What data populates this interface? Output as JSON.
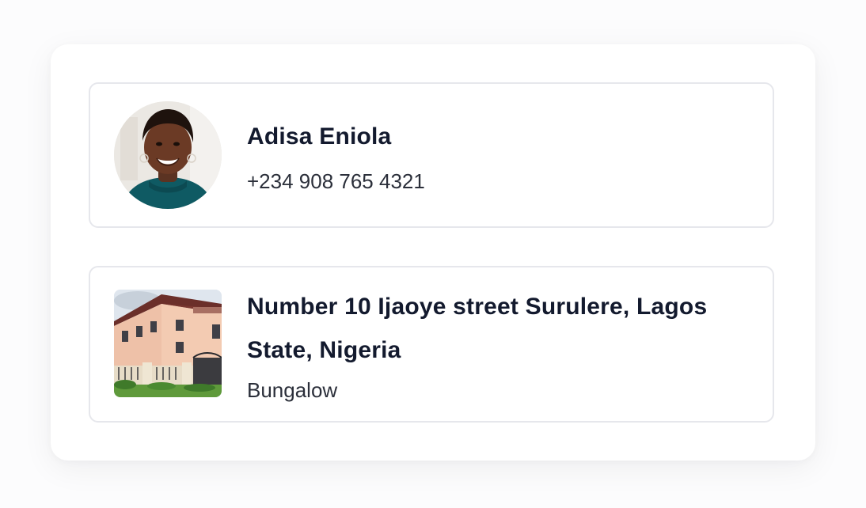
{
  "contact": {
    "name": "Adisa Eniola",
    "phone": "+234 908 765 4321",
    "avatar_icon": "profile-photo"
  },
  "property": {
    "address": "Number 10 Ijaoye street Surulere, Lagos State, Nigeria",
    "type": "Bungalow",
    "image_icon": "house-photo"
  },
  "colors": {
    "heading": "#131a2e",
    "body": "#2b2f3a",
    "border": "#e6e7ec",
    "panel": "#ffffff"
  }
}
